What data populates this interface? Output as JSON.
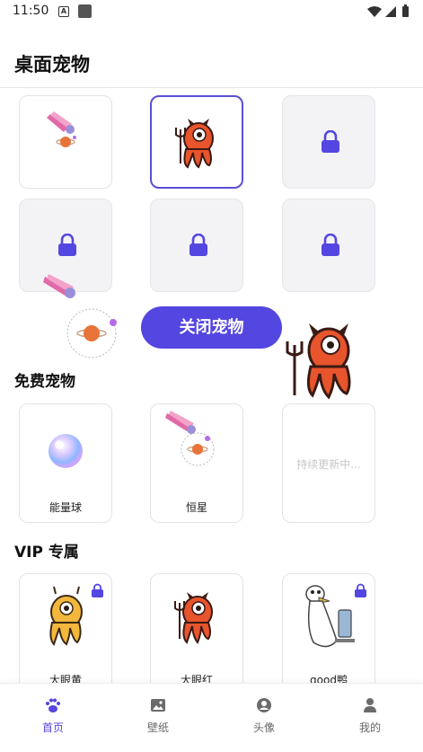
{
  "status_bar": {
    "time": "11:50"
  },
  "header": {
    "title": "桌面宠物"
  },
  "close_button": {
    "label": "关闭宠物"
  },
  "free_section": {
    "title": "免费宠物",
    "items": [
      {
        "label": "能量球"
      },
      {
        "label": "恒星"
      },
      {
        "label": "持续更新中..."
      }
    ]
  },
  "vip_section": {
    "title": "VIP 专属",
    "items": [
      {
        "label": "大眼黄"
      },
      {
        "label": "大眼红"
      },
      {
        "label": "good鸭"
      }
    ]
  },
  "bottom_nav": {
    "items": [
      {
        "label": "首页",
        "icon": "paw-icon",
        "active": true
      },
      {
        "label": "壁纸",
        "icon": "image-icon",
        "active": false
      },
      {
        "label": "头像",
        "icon": "avatar-icon",
        "active": false
      },
      {
        "label": "我的",
        "icon": "person-icon",
        "active": false
      }
    ]
  },
  "colors": {
    "accent": "#5446e0",
    "card_border": "#e3e3e8",
    "locked_bg": "#f3f3f6"
  }
}
